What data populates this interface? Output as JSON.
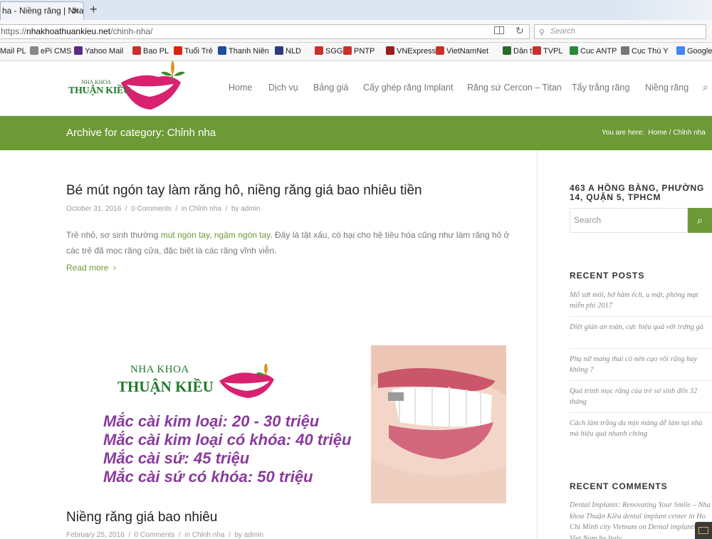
{
  "browser": {
    "tab_title": "ha - Niềng răng | Nha",
    "url_scheme": "https://",
    "url_host": "nhakhoathuankieu.net",
    "url_path": "/chinh-nha/",
    "search_placeholder": "Search",
    "bookmarks": [
      {
        "label": "Mail PL",
        "color": "#c9302c"
      },
      {
        "label": "ePi CMS",
        "color": "#888888"
      },
      {
        "label": "Yahoo Mail",
        "color": "#5b2a86"
      },
      {
        "label": "Bao PL",
        "color": "#c9302c"
      },
      {
        "label": "Tuổi Trẻ",
        "color": "#d9230f"
      },
      {
        "label": "Thanh Niên",
        "color": "#1d4e9b"
      },
      {
        "label": "NLD",
        "color": "#2d3a7b"
      },
      {
        "label": "SGGP",
        "color": "#c9302c"
      },
      {
        "label": "PNTP",
        "color": "#c9302c"
      },
      {
        "label": "VNExpress",
        "color": "#9b1c1c"
      },
      {
        "label": "VietNamNet",
        "color": "#c9302c"
      },
      {
        "label": "Dân trí",
        "color": "#2a6b2a"
      },
      {
        "label": "TVPL",
        "color": "#c9302c"
      },
      {
        "label": "Cuc ANTP",
        "color": "#2a8a3a"
      },
      {
        "label": "Cục Thú Y",
        "color": "#777777"
      },
      {
        "label": "Google",
        "color": "#4285f4"
      }
    ]
  },
  "site": {
    "logo_top": "NHA KHOA",
    "logo_main": "THUẬN KIỀU",
    "nav": [
      "Home",
      "Dịch vụ",
      "Bảng giá",
      "Cấy ghép răng Implant",
      "Răng sứ Cercon – Titan",
      "Tẩy trắng răng",
      "Niềng răng"
    ],
    "accent": "#6d9a36"
  },
  "titlebar": {
    "title": "Archive for category: Chỉnh nha",
    "crumb_prefix": "You are here:",
    "crumb_home": "Home",
    "crumb_sep": "/",
    "crumb_current": "Chỉnh nha"
  },
  "posts": [
    {
      "title": "Bé mút ngón tay làm răng hô, niềng răng giá bao nhiêu tiền",
      "date": "October 31, 2016",
      "comments": "0 Comments",
      "category_prefix": "in",
      "category": "Chỉnh nha",
      "author_prefix": "by",
      "author": "admin",
      "excerpt_before": "Trẻ nhỏ, sơ sinh thường ",
      "excerpt_link": "mút ngón tay, ngậm ngón tay",
      "excerpt_after": ". Đây là tật xấu, có hại cho hệ tiêu hóa cũng như làm răng hô ở các trẻ đã mọc răng cửa, đặc biệt là các răng vĩnh viễn.",
      "read_more": "Read more"
    },
    {
      "title": "Niềng răng giá bao nhiêu",
      "date": "February 25, 2016",
      "comments": "0 Comments",
      "category_prefix": "in",
      "category": "Chỉnh nha",
      "author_prefix": "by",
      "author": "admin"
    }
  ],
  "featured_image": {
    "brand_line1": "NHA KHOA",
    "brand_line2": "THUẬN KIỀU",
    "lines": [
      "Mắc cài kim loại: 20 - 30 triệu",
      "Mắc cài kim loại có khóa: 40 triệu",
      "Mắc cài sứ: 45 triệu",
      "Mắc cài sứ có khóa: 50 triệu"
    ]
  },
  "sidebar": {
    "address": "463 A HỒNG BÀNG, PHƯỜNG 14, QUẬN 5, TPHCM",
    "search_placeholder": "Search",
    "recent_posts_heading": "RECENT POSTS",
    "recent_posts": [
      "Mổ sứt môi, hở hàm ếch, u mặt, phòng mạt miễn phí 2017",
      "Diệt gián an toàn, cực hiệu quả với trứng gà",
      "Phụ nữ mang thai có nên cạo vôi răng hay không ?",
      "Quá trình mọc răng của trẻ sơ sinh đến 32 tháng",
      "Cách làm trắng da mịn màng dễ làm tại nhà mà hiệu quả nhanh chóng"
    ],
    "recent_comments_heading": "RECENT COMMENTS",
    "recent_comment": "Dental Implants: Renovating Your Smile – Nha khoa Thuận Kiều dental implant center in Ho Chi Minh city Vietnam on Dental implants in Viet Nam by Italy"
  }
}
